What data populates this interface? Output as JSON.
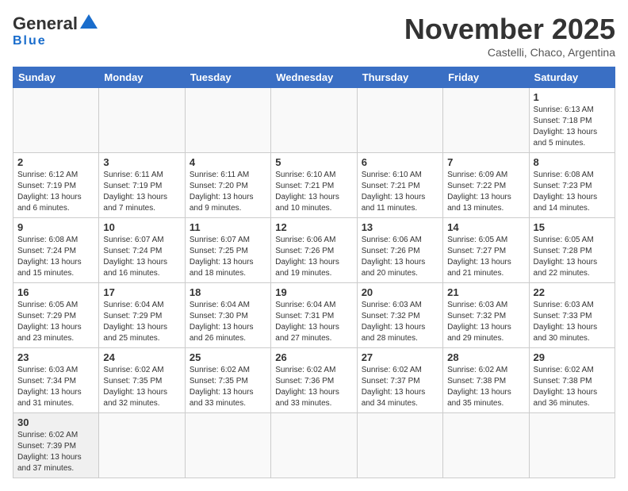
{
  "header": {
    "logo_general": "General",
    "logo_blue": "Blue",
    "month_title": "November 2025",
    "subtitle": "Castelli, Chaco, Argentina"
  },
  "days_of_week": [
    "Sunday",
    "Monday",
    "Tuesday",
    "Wednesday",
    "Thursday",
    "Friday",
    "Saturday"
  ],
  "weeks": [
    [
      {
        "day": "",
        "info": ""
      },
      {
        "day": "",
        "info": ""
      },
      {
        "day": "",
        "info": ""
      },
      {
        "day": "",
        "info": ""
      },
      {
        "day": "",
        "info": ""
      },
      {
        "day": "",
        "info": ""
      },
      {
        "day": "1",
        "info": "Sunrise: 6:13 AM\nSunset: 7:18 PM\nDaylight: 13 hours and 5 minutes."
      }
    ],
    [
      {
        "day": "2",
        "info": "Sunrise: 6:12 AM\nSunset: 7:19 PM\nDaylight: 13 hours and 6 minutes."
      },
      {
        "day": "3",
        "info": "Sunrise: 6:11 AM\nSunset: 7:19 PM\nDaylight: 13 hours and 7 minutes."
      },
      {
        "day": "4",
        "info": "Sunrise: 6:11 AM\nSunset: 7:20 PM\nDaylight: 13 hours and 9 minutes."
      },
      {
        "day": "5",
        "info": "Sunrise: 6:10 AM\nSunset: 7:21 PM\nDaylight: 13 hours and 10 minutes."
      },
      {
        "day": "6",
        "info": "Sunrise: 6:10 AM\nSunset: 7:21 PM\nDaylight: 13 hours and 11 minutes."
      },
      {
        "day": "7",
        "info": "Sunrise: 6:09 AM\nSunset: 7:22 PM\nDaylight: 13 hours and 13 minutes."
      },
      {
        "day": "8",
        "info": "Sunrise: 6:08 AM\nSunset: 7:23 PM\nDaylight: 13 hours and 14 minutes."
      }
    ],
    [
      {
        "day": "9",
        "info": "Sunrise: 6:08 AM\nSunset: 7:24 PM\nDaylight: 13 hours and 15 minutes."
      },
      {
        "day": "10",
        "info": "Sunrise: 6:07 AM\nSunset: 7:24 PM\nDaylight: 13 hours and 16 minutes."
      },
      {
        "day": "11",
        "info": "Sunrise: 6:07 AM\nSunset: 7:25 PM\nDaylight: 13 hours and 18 minutes."
      },
      {
        "day": "12",
        "info": "Sunrise: 6:06 AM\nSunset: 7:26 PM\nDaylight: 13 hours and 19 minutes."
      },
      {
        "day": "13",
        "info": "Sunrise: 6:06 AM\nSunset: 7:26 PM\nDaylight: 13 hours and 20 minutes."
      },
      {
        "day": "14",
        "info": "Sunrise: 6:05 AM\nSunset: 7:27 PM\nDaylight: 13 hours and 21 minutes."
      },
      {
        "day": "15",
        "info": "Sunrise: 6:05 AM\nSunset: 7:28 PM\nDaylight: 13 hours and 22 minutes."
      }
    ],
    [
      {
        "day": "16",
        "info": "Sunrise: 6:05 AM\nSunset: 7:29 PM\nDaylight: 13 hours and 23 minutes."
      },
      {
        "day": "17",
        "info": "Sunrise: 6:04 AM\nSunset: 7:29 PM\nDaylight: 13 hours and 25 minutes."
      },
      {
        "day": "18",
        "info": "Sunrise: 6:04 AM\nSunset: 7:30 PM\nDaylight: 13 hours and 26 minutes."
      },
      {
        "day": "19",
        "info": "Sunrise: 6:04 AM\nSunset: 7:31 PM\nDaylight: 13 hours and 27 minutes."
      },
      {
        "day": "20",
        "info": "Sunrise: 6:03 AM\nSunset: 7:32 PM\nDaylight: 13 hours and 28 minutes."
      },
      {
        "day": "21",
        "info": "Sunrise: 6:03 AM\nSunset: 7:32 PM\nDaylight: 13 hours and 29 minutes."
      },
      {
        "day": "22",
        "info": "Sunrise: 6:03 AM\nSunset: 7:33 PM\nDaylight: 13 hours and 30 minutes."
      }
    ],
    [
      {
        "day": "23",
        "info": "Sunrise: 6:03 AM\nSunset: 7:34 PM\nDaylight: 13 hours and 31 minutes."
      },
      {
        "day": "24",
        "info": "Sunrise: 6:02 AM\nSunset: 7:35 PM\nDaylight: 13 hours and 32 minutes."
      },
      {
        "day": "25",
        "info": "Sunrise: 6:02 AM\nSunset: 7:35 PM\nDaylight: 13 hours and 33 minutes."
      },
      {
        "day": "26",
        "info": "Sunrise: 6:02 AM\nSunset: 7:36 PM\nDaylight: 13 hours and 33 minutes."
      },
      {
        "day": "27",
        "info": "Sunrise: 6:02 AM\nSunset: 7:37 PM\nDaylight: 13 hours and 34 minutes."
      },
      {
        "day": "28",
        "info": "Sunrise: 6:02 AM\nSunset: 7:38 PM\nDaylight: 13 hours and 35 minutes."
      },
      {
        "day": "29",
        "info": "Sunrise: 6:02 AM\nSunset: 7:38 PM\nDaylight: 13 hours and 36 minutes."
      }
    ],
    [
      {
        "day": "30",
        "info": "Sunrise: 6:02 AM\nSunset: 7:39 PM\nDaylight: 13 hours and 37 minutes."
      },
      {
        "day": "",
        "info": ""
      },
      {
        "day": "",
        "info": ""
      },
      {
        "day": "",
        "info": ""
      },
      {
        "day": "",
        "info": ""
      },
      {
        "day": "",
        "info": ""
      },
      {
        "day": "",
        "info": ""
      }
    ]
  ]
}
